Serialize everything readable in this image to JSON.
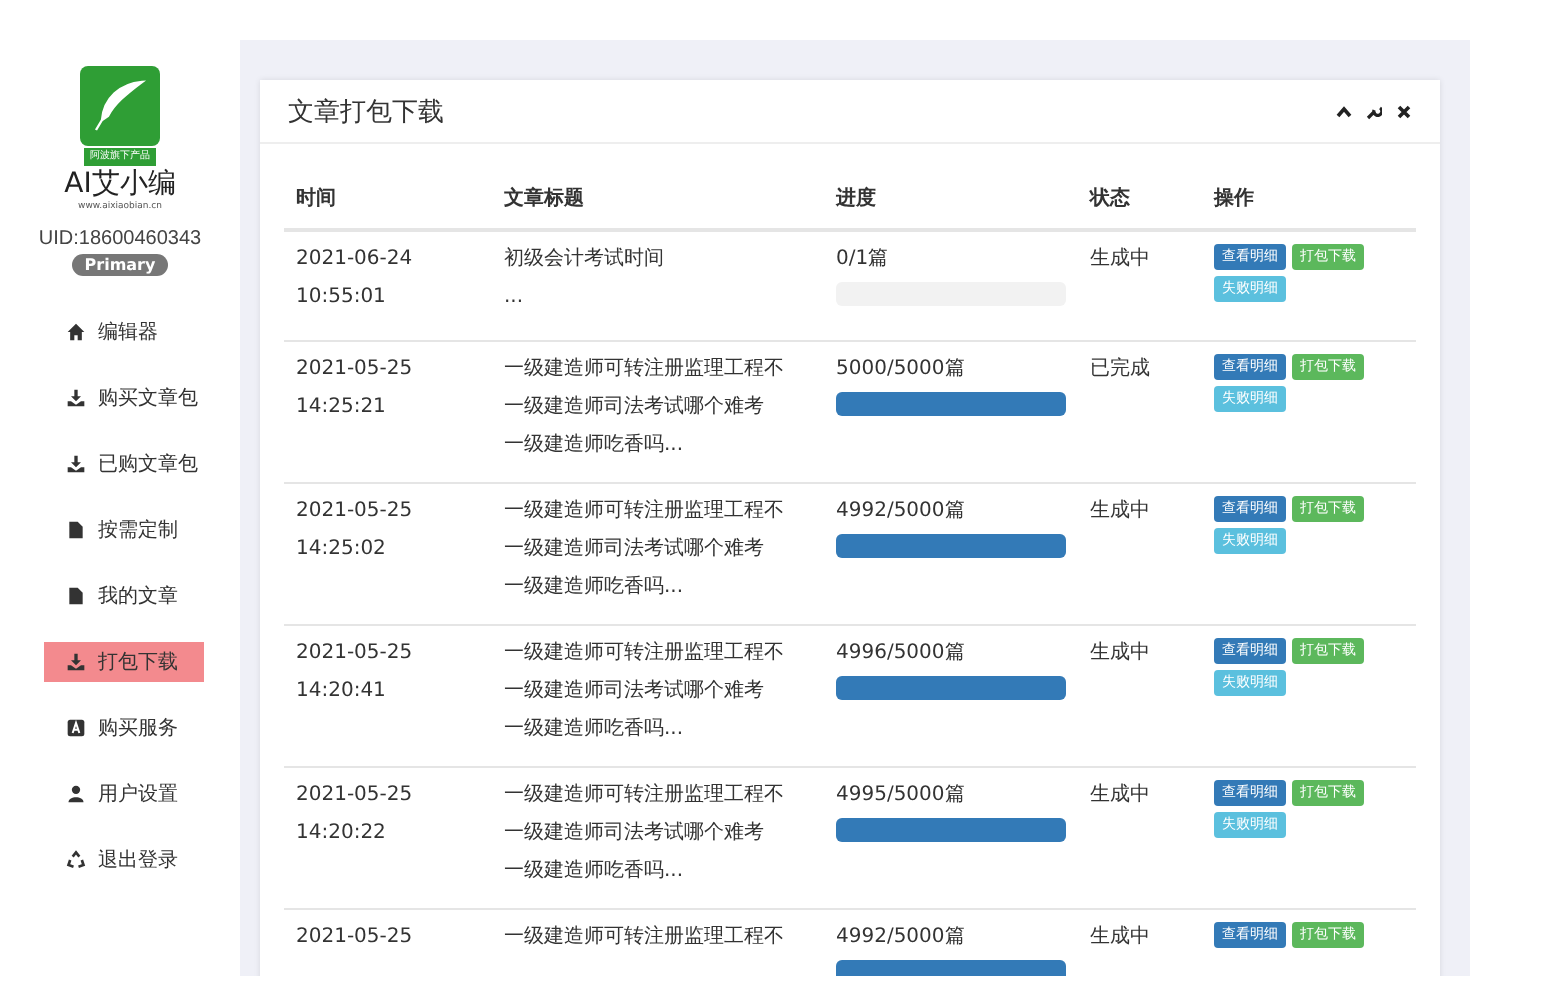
{
  "sidebar": {
    "logo_tag": "阿波旗下产品",
    "brand": "AI艾小编",
    "url": "www.aixiaobian.cn",
    "uid": "UID:18600460343",
    "badge": "Primary",
    "items": [
      {
        "kind": "home",
        "label": "编辑器",
        "selected": false
      },
      {
        "kind": "download",
        "label": "购买文章包",
        "selected": false
      },
      {
        "kind": "download",
        "label": "已购文章包",
        "selected": false
      },
      {
        "kind": "file",
        "label": "按需定制",
        "selected": false
      },
      {
        "kind": "file",
        "label": "我的文章",
        "selected": false
      },
      {
        "kind": "download",
        "label": "打包下载",
        "selected": true
      },
      {
        "kind": "letter",
        "label": "购买服务",
        "selected": false
      },
      {
        "kind": "user",
        "label": "用户设置",
        "selected": false
      },
      {
        "kind": "recycle",
        "label": "退出登录",
        "selected": false
      }
    ]
  },
  "panel": {
    "title": "文章打包下载",
    "table": {
      "columns": [
        "时间",
        "文章标题",
        "进度",
        "状态",
        "操作"
      ],
      "rows": [
        {
          "time": [
            "2021-06-24",
            "10:55:01"
          ],
          "title": [
            "初级会计考试时间",
            "..."
          ],
          "progress": "0/1篇",
          "level": 0,
          "status": "生成中",
          "actions": [
            {
              "kind": "view",
              "label": "查看明细"
            },
            {
              "kind": "download",
              "label": "打包下载"
            },
            {
              "kind": "fail",
              "label": "失败明细"
            }
          ]
        },
        {
          "time": [
            "2021-05-25",
            "14:25:21"
          ],
          "title": [
            "一级建造师可转注册监理工程不",
            "一级建造师司法考试哪个难考",
            "一级建造师吃香吗..."
          ],
          "progress": "5000/5000篇",
          "level": 1,
          "status": "已完成",
          "actions": [
            {
              "kind": "view",
              "label": "查看明细"
            },
            {
              "kind": "download",
              "label": "打包下载"
            },
            {
              "kind": "fail",
              "label": "失败明细"
            }
          ]
        },
        {
          "time": [
            "2021-05-25",
            "14:25:02"
          ],
          "title": [
            "一级建造师可转注册监理工程不",
            "一级建造师司法考试哪个难考",
            "一级建造师吃香吗..."
          ],
          "progress": "4992/5000篇",
          "level": 0.998,
          "status": "生成中",
          "actions": [
            {
              "kind": "view",
              "label": "查看明细"
            },
            {
              "kind": "download",
              "label": "打包下载"
            },
            {
              "kind": "fail",
              "label": "失败明细"
            }
          ]
        },
        {
          "time": [
            "2021-05-25",
            "14:20:41"
          ],
          "title": [
            "一级建造师可转注册监理工程不",
            "一级建造师司法考试哪个难考",
            "一级建造师吃香吗..."
          ],
          "progress": "4996/5000篇",
          "level": 0.999,
          "status": "生成中",
          "actions": [
            {
              "kind": "view",
              "label": "查看明细"
            },
            {
              "kind": "download",
              "label": "打包下载"
            },
            {
              "kind": "fail",
              "label": "失败明细"
            }
          ]
        },
        {
          "time": [
            "2021-05-25",
            "14:20:22"
          ],
          "title": [
            "一级建造师可转注册监理工程不",
            "一级建造师司法考试哪个难考",
            "一级建造师吃香吗..."
          ],
          "progress": "4995/5000篇",
          "level": 0.999,
          "status": "生成中",
          "actions": [
            {
              "kind": "view",
              "label": "查看明细"
            },
            {
              "kind": "download",
              "label": "打包下载"
            },
            {
              "kind": "fail",
              "label": "失败明细"
            }
          ]
        },
        {
          "time": [
            "2021-05-25"
          ],
          "title": [
            "一级建造师可转注册监理工程不"
          ],
          "progress": "4992/5000篇",
          "level": 0.998,
          "status": "生成中",
          "actions": [
            {
              "kind": "view",
              "label": "查看明细"
            },
            {
              "kind": "download",
              "label": "打包下载"
            }
          ]
        }
      ]
    }
  }
}
